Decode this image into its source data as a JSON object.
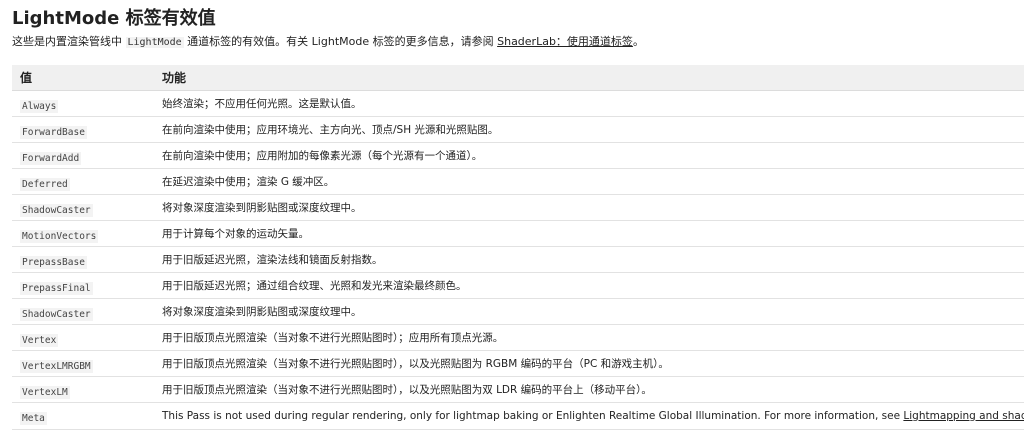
{
  "heading": "LightMode 标签有效值",
  "intro": {
    "text_before": "这些是内置渲染管线中 ",
    "code": "LightMode",
    "text_middle": " 通道标签的有效值。有关 LightMode 标签的更多信息，请参阅 ",
    "link": "ShaderLab：使用通道标签",
    "text_after": "。"
  },
  "table": {
    "headers": [
      "值",
      "功能"
    ],
    "rows": [
      {
        "value": "Always",
        "desc": "始终渲染；不应用任何光照。这是默认值。"
      },
      {
        "value": "ForwardBase",
        "desc": "在前向渲染中使用；应用环境光、主方向光、顶点/SH 光源和光照贴图。"
      },
      {
        "value": "ForwardAdd",
        "desc": "在前向渲染中使用；应用附加的每像素光源（每个光源有一个通道）。"
      },
      {
        "value": "Deferred",
        "desc": "在延迟渲染中使用；渲染 G 缓冲区。"
      },
      {
        "value": "ShadowCaster",
        "desc": "将对象深度渲染到阴影贴图或深度纹理中。"
      },
      {
        "value": "MotionVectors",
        "desc": "用于计算每个对象的运动矢量。"
      },
      {
        "value": "PrepassBase",
        "desc": "用于旧版延迟光照，渲染法线和镜面反射指数。"
      },
      {
        "value": "PrepassFinal",
        "desc": "用于旧版延迟光照；通过组合纹理、光照和发光来渲染最终颜色。"
      },
      {
        "value": "ShadowCaster",
        "desc": "将对象深度渲染到阴影贴图或深度纹理中。"
      },
      {
        "value": "Vertex",
        "desc": "用于旧版顶点光照渲染（当对象不进行光照贴图时）；应用所有顶点光源。"
      },
      {
        "value": "VertexLMRGBM",
        "desc": "用于旧版顶点光照渲染（当对象不进行光照贴图时），以及光照贴图为 RGBM 编码的平台（PC 和游戏主机）。"
      },
      {
        "value": "VertexLM",
        "desc": "用于旧版顶点光照渲染（当对象不进行光照贴图时），以及光照贴图为双 LDR 编码的平台上（移动平台）。"
      }
    ],
    "meta_row": {
      "value": "Meta",
      "desc_before": "This Pass is not used during regular rendering, only for lightmap baking or Enlighten Realtime Global Illumination. For more information, see ",
      "link": "Lightmapping and shaders",
      "desc_after": "."
    }
  }
}
